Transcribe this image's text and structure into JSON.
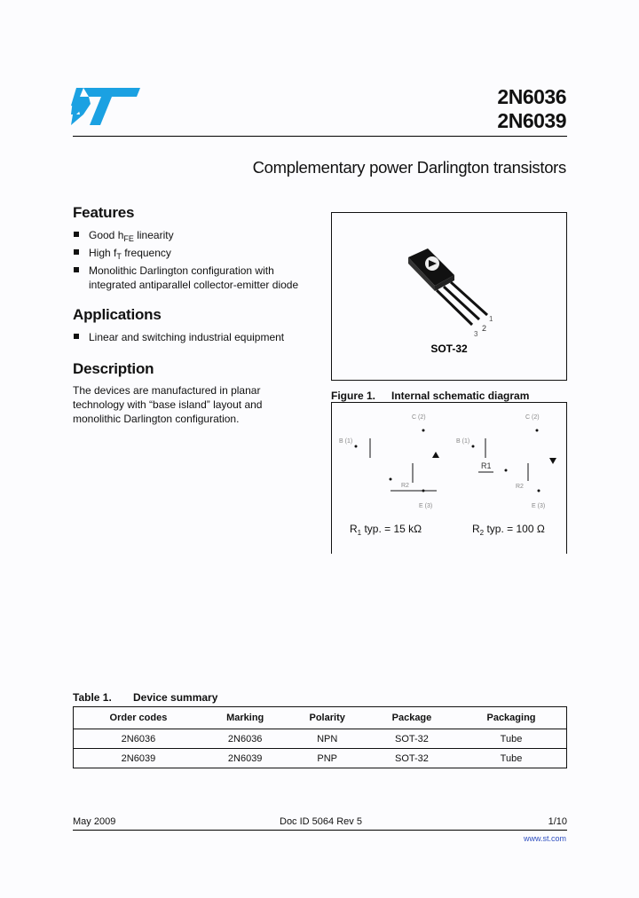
{
  "header": {
    "logo": "st-logo",
    "part_numbers": [
      "2N6036",
      "2N6039"
    ],
    "subtitle": "Complementary power Darlington transistors"
  },
  "features": {
    "title": "Features",
    "items": [
      {
        "pre": "Good h",
        "sub": "FE",
        "post": " linearity"
      },
      {
        "pre": "High f",
        "sub": "T",
        "post": " frequency"
      },
      {
        "pre": "Monolithic Darlington configuration with integrated antiparallel collector-emitter diode",
        "sub": "",
        "post": ""
      }
    ]
  },
  "applications": {
    "title": "Applications",
    "items": [
      "Linear and switching industrial equipment"
    ]
  },
  "description": {
    "title": "Description",
    "text": "The devices are manufactured in planar technology with “base island” layout and monolithic Darlington configuration."
  },
  "package_figure": {
    "label": "SOT-32",
    "pins": [
      "1",
      "2",
      "3"
    ]
  },
  "figure1": {
    "number": "Figure 1.",
    "title": "Internal schematic diagram",
    "labels": {
      "npn_collector": "C (2)",
      "npn_base": "B (1)",
      "npn_emitter": "E (3)",
      "npn_r": "R2",
      "pnp_collector": "C (2)",
      "pnp_base": "B (1)",
      "pnp_emitter": "E (3)",
      "pnp_r1": "R1",
      "pnp_r2": "R2"
    },
    "r1_text": {
      "pre": "R",
      "sub": "1",
      "post": " typ. = 15 kΩ"
    },
    "r2_text": {
      "pre": "R",
      "sub": "2",
      "post": " typ. = 100 Ω"
    }
  },
  "table1": {
    "number": "Table 1.",
    "title": "Device summary",
    "headers": [
      "Order codes",
      "Marking",
      "Polarity",
      "Package",
      "Packaging"
    ],
    "rows": [
      [
        "2N6036",
        "2N6036",
        "NPN",
        "SOT-32",
        "Tube"
      ],
      [
        "2N6039",
        "2N6039",
        "PNP",
        "SOT-32",
        "Tube"
      ]
    ]
  },
  "footer": {
    "date": "May 2009",
    "doc_id": "Doc ID 5064 Rev 5",
    "page": "1/10",
    "url": "www.st.com"
  },
  "colors": {
    "brand_blue": "#1ba1e2",
    "url_blue": "#3050c0"
  }
}
